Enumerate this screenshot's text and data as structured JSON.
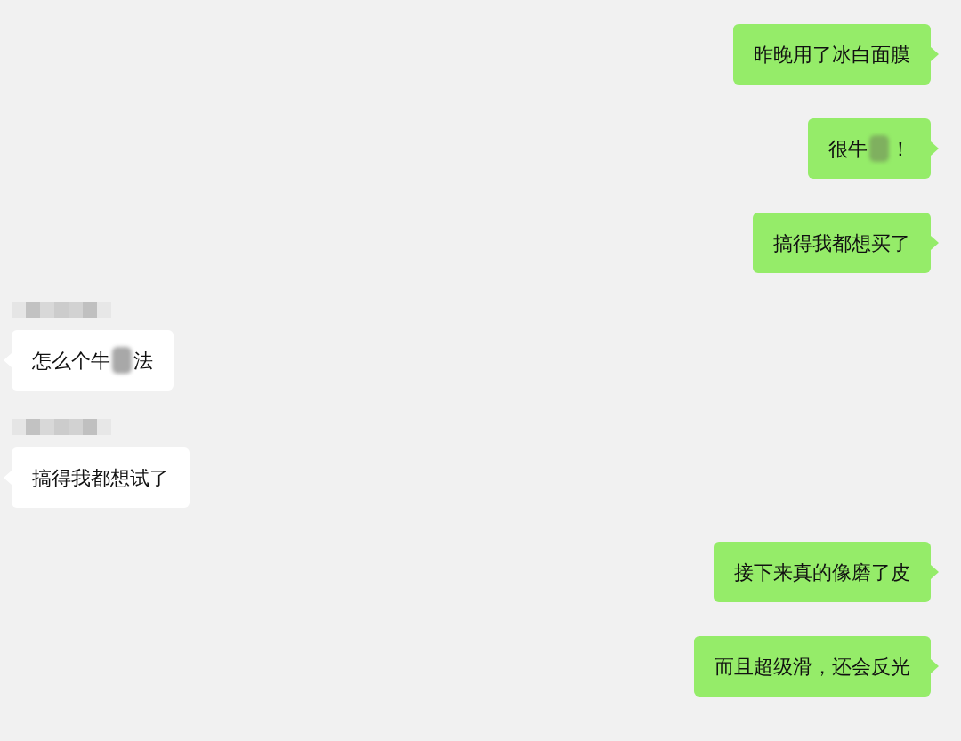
{
  "messages": [
    {
      "kind": "outgoing",
      "sender_redacted": false,
      "parts": [
        {
          "kind": "text",
          "text": "昨晚用了冰白面膜"
        }
      ]
    },
    {
      "kind": "outgoing",
      "sender_redacted": false,
      "parts": [
        {
          "kind": "text",
          "text": "很牛"
        },
        {
          "kind": "redacted"
        },
        {
          "kind": "text",
          "text": "！"
        }
      ]
    },
    {
      "kind": "outgoing",
      "sender_redacted": false,
      "parts": [
        {
          "kind": "text",
          "text": "搞得我都想买了"
        }
      ]
    },
    {
      "kind": "incoming",
      "sender_redacted": true,
      "parts": [
        {
          "kind": "text",
          "text": "怎么个牛"
        },
        {
          "kind": "redacted"
        },
        {
          "kind": "text",
          "text": "法"
        }
      ]
    },
    {
      "kind": "incoming",
      "sender_redacted": true,
      "parts": [
        {
          "kind": "text",
          "text": "搞得我都想试了"
        }
      ]
    },
    {
      "kind": "outgoing",
      "sender_redacted": false,
      "parts": [
        {
          "kind": "text",
          "text": "接下来真的像磨了皮"
        }
      ]
    },
    {
      "kind": "outgoing",
      "sender_redacted": false,
      "parts": [
        {
          "kind": "text",
          "text": "而且超级滑，还会反光"
        }
      ]
    }
  ]
}
